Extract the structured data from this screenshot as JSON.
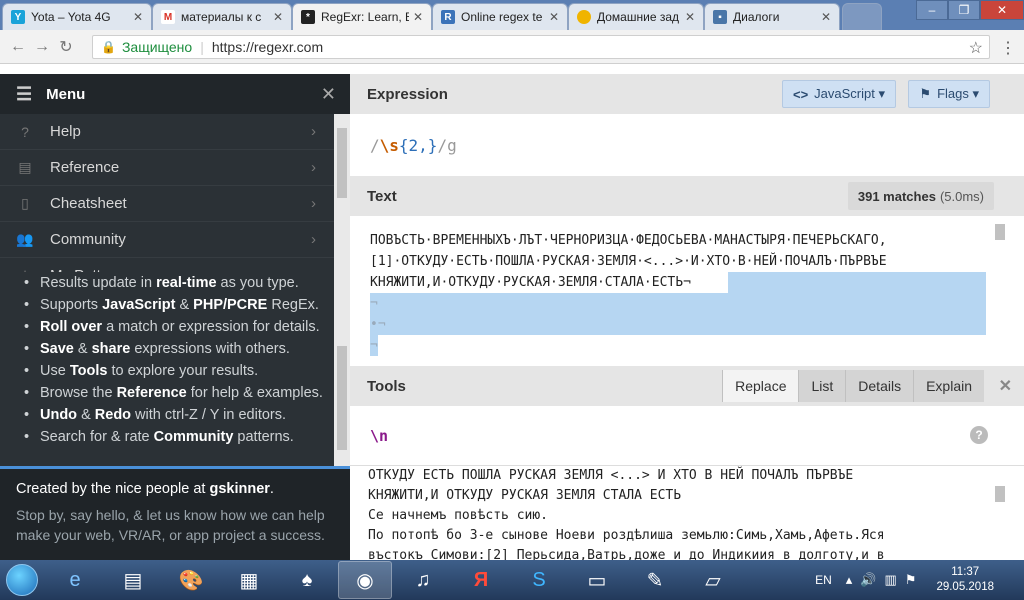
{
  "browser": {
    "tabs": [
      {
        "label": "Yota – Yota 4G",
        "icon": "yota-icon"
      },
      {
        "label": "материалы к с",
        "icon": "gmail-icon"
      },
      {
        "label": "RegExr: Learn, B",
        "icon": "regexr-icon"
      },
      {
        "label": "Online regex te",
        "icon": "regex101-icon"
      },
      {
        "label": "Домашние зад",
        "icon": "circle-icon"
      },
      {
        "label": "Диалоги",
        "icon": "chat-icon"
      }
    ],
    "secure_label": "Защищено",
    "url": "https://regexr.com"
  },
  "sidebar": {
    "title": "Menu",
    "items": [
      {
        "label": "Help"
      },
      {
        "label": "Reference"
      },
      {
        "label": "Cheatsheet"
      },
      {
        "label": "Community"
      },
      {
        "label": "My Patterns"
      }
    ],
    "info": [
      {
        "pre": "Results update in ",
        "b": "real-time",
        "post": " as you type."
      },
      {
        "pre": "Supports ",
        "b": "JavaScript",
        "mid": " & ",
        "b2": "PHP/PCRE",
        "post": " RegEx."
      },
      {
        "pre": "",
        "b": "Roll over",
        "post": " a match or expression for details."
      },
      {
        "pre": "",
        "b": "Save",
        "mid": " & ",
        "b2": "share",
        "post": " expressions with others."
      },
      {
        "pre": "Use ",
        "b": "Tools",
        "post": " to explore your results."
      },
      {
        "pre": "Browse the ",
        "b": "Reference",
        "post": " for help & examples."
      },
      {
        "pre": "",
        "b": "Undo",
        "mid": " & ",
        "b2": "Redo",
        "post": " with ctrl-Z / Y in editors."
      },
      {
        "pre": "Search for & rate ",
        "b": "Community",
        "post": " patterns."
      }
    ],
    "credit_pre": "Created by the nice people at ",
    "credit_link": "gskinner",
    "credit_post": ".",
    "credit_body": "Stop by, say hello, & let us know how we can help make your web, VR/AR, or app project a success."
  },
  "expression": {
    "title": "Expression",
    "lang_button": "JavaScript ▾",
    "flags_button": "Flags ▾",
    "open": "/",
    "esc": "\\s",
    "quant": "{2,}",
    "close": "/g"
  },
  "text": {
    "title": "Text",
    "matches": "391 matches",
    "time": "(5.0ms)",
    "lines": [
      "ПОВЪСТЬ·ВРЕМЕННЫХЪ·ЛЪТ·ЧЕРНОРИЗЦА·ФЕДОСЬЕВА·МАНАСТЫРЯ·ПЕЧЕРЬСКАГО,",
      "[1]·ОТКУДУ·ЕСТЬ·ПОШЛА·РУСКАЯ·ЗЕМЛЯ·<...>·И·ХТО·В·НЕЙ·ПОЧАЛЪ·ПЪРВЪЕ",
      "КНЯЖИТИ,И·ОТКУДУ·РУСКАЯ·ЗЕМЛЯ·СТАЛА·ЕСТЬ¬",
      "¬",
      "•¬",
      "¬"
    ]
  },
  "tools": {
    "title": "Tools",
    "tabs": [
      "Replace",
      "List",
      "Details",
      "Explain"
    ],
    "active_tab": "Replace",
    "expression": "\\n",
    "result_lines": [
      "ОТКУДУ ЕСТЬ ПОШЛА РУСКАЯ ЗЕМЛЯ <...> И ХТО В НЕЙ ПОЧАЛЪ ПЪРВЪЕ",
      "КНЯЖИТИ,И ОТКУДУ РУСКАЯ ЗЕМЛЯ СТАЛА ЕСТЬ",
      "Се начнемъ повѣсть сию.",
      "По потопѣ бо 3-е сынове Ноеви роздѣлиша земьлю:Симь,Хамь,Афеть.Яся",
      "въстокъ Симови:[2] Перьсида,Ватрь,доже и до Индикиия в долготу,и в"
    ]
  },
  "taskbar": {
    "lang": "EN",
    "time": "11:37",
    "date": "29.05.2018"
  }
}
